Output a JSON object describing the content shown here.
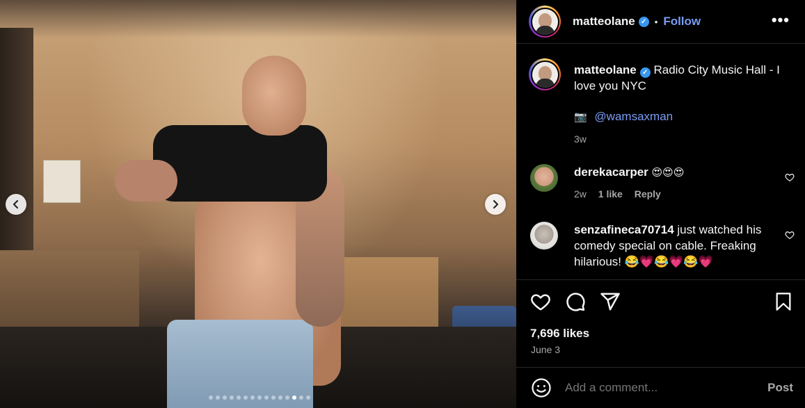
{
  "post": {
    "username": "matteolane",
    "verified_icon": "verified-badge-icon",
    "follow_label": "Follow",
    "more_label": "•••",
    "dot": "•"
  },
  "caption": {
    "username": "matteolane",
    "text": "Radio City Music Hall - I love you NYC",
    "camera_emoji": "📷",
    "mention": "@wamsaxman",
    "time": "3w"
  },
  "comments": [
    {
      "username": "derekacarper",
      "text": "😍😍😍",
      "time": "2w",
      "likes": "1 like",
      "reply": "Reply"
    },
    {
      "username": "senzafineca70714",
      "text": "just watched his comedy special on cable. Freaking hilarious! 😂💗😂💗😂💗",
      "time": "",
      "likes": "",
      "reply": ""
    }
  ],
  "carousel": {
    "prev_icon": "chevron-left-icon",
    "next_icon": "chevron-right-icon",
    "total_slides": 15,
    "active_slide": 12
  },
  "engagement": {
    "likes": "7,696 likes",
    "date": "June 3"
  },
  "add_comment": {
    "placeholder": "Add a comment...",
    "post_label": "Post"
  },
  "colors": {
    "background": "#000000",
    "link_blue": "#7a9cf5",
    "muted": "#a8a8a8",
    "verified": "#3897f0"
  }
}
